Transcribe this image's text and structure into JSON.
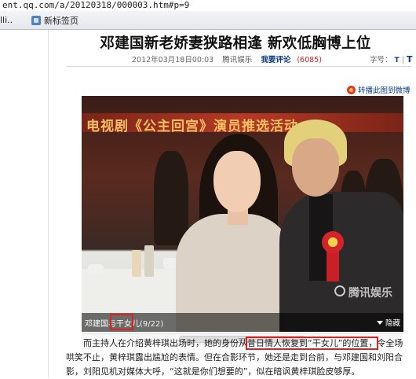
{
  "browser": {
    "url": "ent.qq.com/a/20120318/000003.htm#p=9",
    "bookmark_left": "lli..",
    "bookmark_item": "新标签页"
  },
  "article": {
    "headline": "邓建国新老娇妻狭路相逢 新欢低胸博上位",
    "date": "2012年03月18日00:03",
    "source": "腾讯娱乐",
    "comment_label": "我要评论",
    "comment_count": "(6085)",
    "font_size_label": "字号：",
    "font_size_small": "T",
    "font_size_large": "T",
    "share_label": "转播此图到微博"
  },
  "photo": {
    "banner_text": "电视剧《公主回宫》演员推选活动",
    "caption_prefix": "邓建国与",
    "caption_highlight": "干女儿",
    "caption_count": "(9/22)",
    "watermark": "腾讯娱乐",
    "hide_label": "隐藏"
  },
  "body": {
    "p1_before": "而主持人在介绍黄梓琪出场时，她的身份从",
    "p1_highlight": "昔日情人恢复到“干女儿”的位置，",
    "p1_after": "令全场哄笑不止，黄梓琪露出尴尬的表情。但在合影环节，她还是走到台前，与邓建国和刘阳合影，刘阳见机对媒体大呼，“这就是你们想要的”，似在暗讽黄梓琪脸皮够厚。"
  },
  "colors": {
    "link_blue": "#0b3b8c",
    "highlight_red": "#e02020",
    "comment_count_red": "#d02020"
  }
}
